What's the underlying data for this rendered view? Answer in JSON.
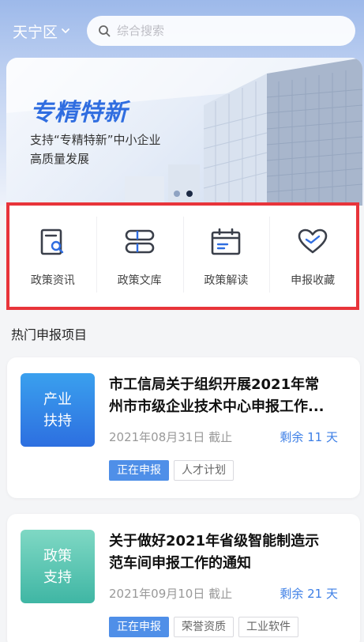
{
  "header": {
    "district": "天宁区",
    "search_placeholder": "综合搜索"
  },
  "banner": {
    "title": "专精特新",
    "subtitle_line1": "支持“专精特新”中小企业",
    "subtitle_line2": "高质量发展",
    "slide_count": 2,
    "active_slide": 2
  },
  "quick_menu": [
    {
      "label": "政策资讯",
      "icon": "search-document-icon"
    },
    {
      "label": "政策文库",
      "icon": "database-icon"
    },
    {
      "label": "政策解读",
      "icon": "calendar-icon"
    },
    {
      "label": "申报收藏",
      "icon": "heart-icon"
    }
  ],
  "section": {
    "title": "热门申报项目"
  },
  "projects": [
    {
      "badge_line1": "产业",
      "badge_line2": "扶持",
      "title_line1": "市工信局关于组织开展2021年常",
      "title_line2": "州市市级企业技术中心申报工作...",
      "date": "2021年08月31日 截止",
      "remaining": "剩余 11 天",
      "tags": [
        "正在申报",
        "人才计划"
      ]
    },
    {
      "badge_line1": "政策",
      "badge_line2": "支持",
      "title_line1": "关于做好2021年省级智能制造示",
      "title_line2": "范车间申报工作的通知",
      "date": "2021年09月10日 截止",
      "remaining": "剩余 21 天",
      "tags": [
        "正在申报",
        "荣誉资质",
        "工业软件"
      ]
    }
  ],
  "colors": {
    "accent": "#2f6de0",
    "highlight_border": "#e8343a",
    "tag_active": "#4f8fe8"
  }
}
